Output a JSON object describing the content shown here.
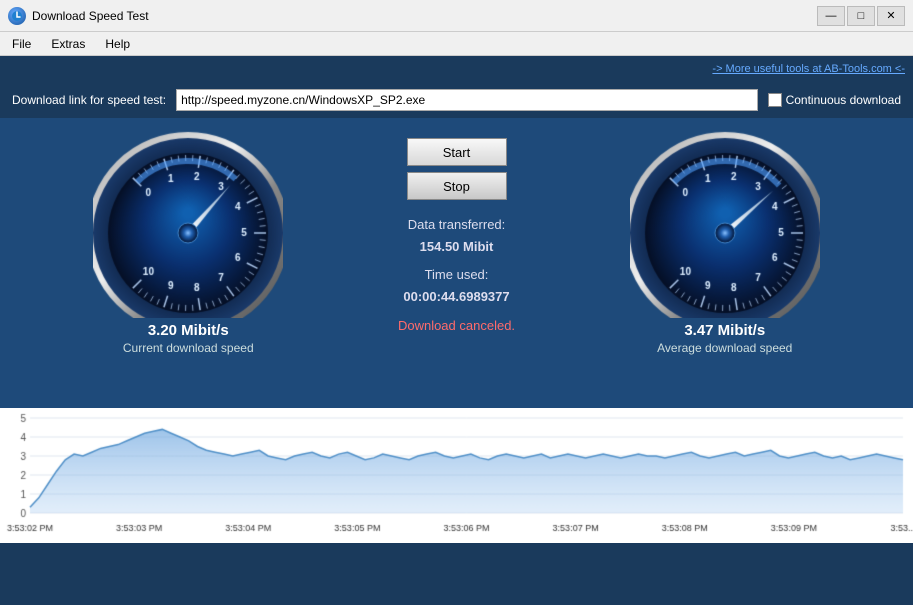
{
  "titlebar": {
    "title": "Download Speed Test",
    "min_label": "—",
    "max_label": "□",
    "close_label": "✕"
  },
  "menubar": {
    "items": [
      "File",
      "Extras",
      "Help"
    ]
  },
  "toplink": {
    "text": "-> More useful tools at AB-Tools.com <-"
  },
  "urlrow": {
    "label": "Download link for speed test:",
    "url_value": "http://speed.myzone.cn/WindowsXP_SP2.exe",
    "url_placeholder": "",
    "continuous_label": "Continuous download"
  },
  "buttons": {
    "start": "Start",
    "stop": "Stop"
  },
  "stats": {
    "transferred_label": "Data transferred:",
    "transferred_value": "154.50 Mibit",
    "time_label": "Time used:",
    "time_value": "00:00:44.6989377",
    "status": "Download canceled."
  },
  "left_gauge": {
    "speed": "3.20 Mibit/s",
    "label": "Current download speed",
    "needle_angle": -45,
    "numbers": [
      "0",
      "2",
      "4",
      "6",
      "8",
      "10"
    ],
    "tick_numbers": [
      "0",
      "1",
      "2",
      "3",
      "4",
      "5",
      "6",
      "7",
      "8",
      "9",
      "10"
    ]
  },
  "right_gauge": {
    "speed": "3.47 Mibit/s",
    "label": "Average download speed",
    "needle_angle": -42
  },
  "chart": {
    "y_labels": [
      "5",
      "4",
      "3",
      "2",
      "1"
    ],
    "x_labels": [
      "3:53:02 PM",
      "3:53:03 PM",
      "3:53:04 PM",
      "3:53:05 PM",
      "3:53:06 PM",
      "3:53:07 PM",
      "3:53:08 PM",
      "3:53:09 PM",
      "3:53..."
    ],
    "accent_color": "#4a90c8"
  }
}
